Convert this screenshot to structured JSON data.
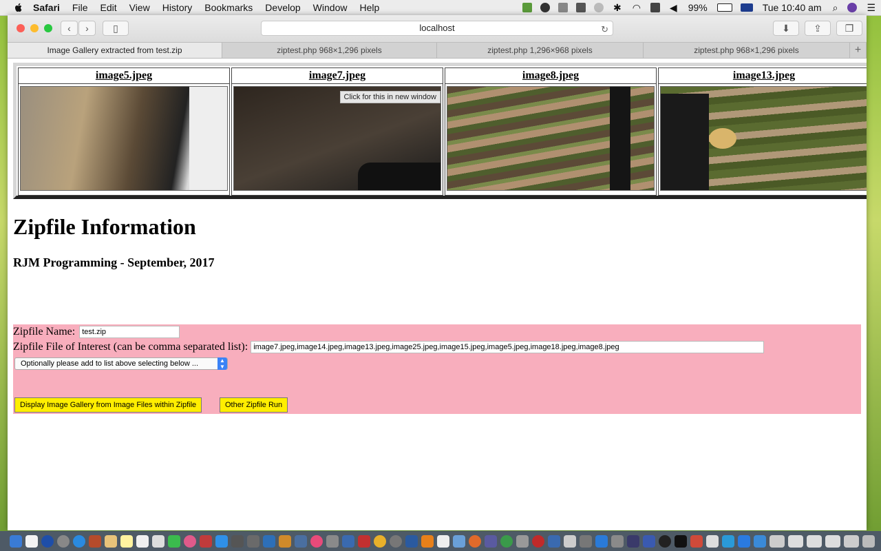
{
  "menubar": {
    "app": "Safari",
    "items": [
      "File",
      "Edit",
      "View",
      "History",
      "Bookmarks",
      "Develop",
      "Window",
      "Help"
    ],
    "battery": "99%",
    "clock": "Tue 10:40 am"
  },
  "toolbar": {
    "address": "localhost"
  },
  "tabs": [
    {
      "label": "Image Gallery extracted from test.zip"
    },
    {
      "label": "ziptest.php 968×1,296 pixels"
    },
    {
      "label": "ziptest.php 1,296×968 pixels"
    },
    {
      "label": "ziptest.php 968×1,296 pixels"
    }
  ],
  "gallery": {
    "images": [
      {
        "title": "image5.jpeg"
      },
      {
        "title": "image7.jpeg"
      },
      {
        "title": "image8.jpeg"
      },
      {
        "title": "image13.jpeg"
      }
    ],
    "tooltip": "Click for this in new window"
  },
  "page": {
    "heading": "Zipfile Information",
    "subheading": "RJM Programming - September, 2017"
  },
  "form": {
    "zip_name_label": "Zipfile Name:",
    "zip_name_value": "test.zip",
    "interest_label": "Zipfile File of Interest (can be comma separated list):",
    "interest_value": "image7.jpeg,image14.jpeg,image13.jpeg,image25.jpeg,image15.jpeg,image5.jpeg,image18.jpeg,image8.jpeg",
    "select_value": "Optionally please add to list above selecting below ...",
    "display_button": "Display Image Gallery from Image Files within Zipfile",
    "other_button": "Other Zipfile Run"
  },
  "colors": {
    "form_bg": "#f8aebd",
    "button_bg": "#ffee00"
  }
}
